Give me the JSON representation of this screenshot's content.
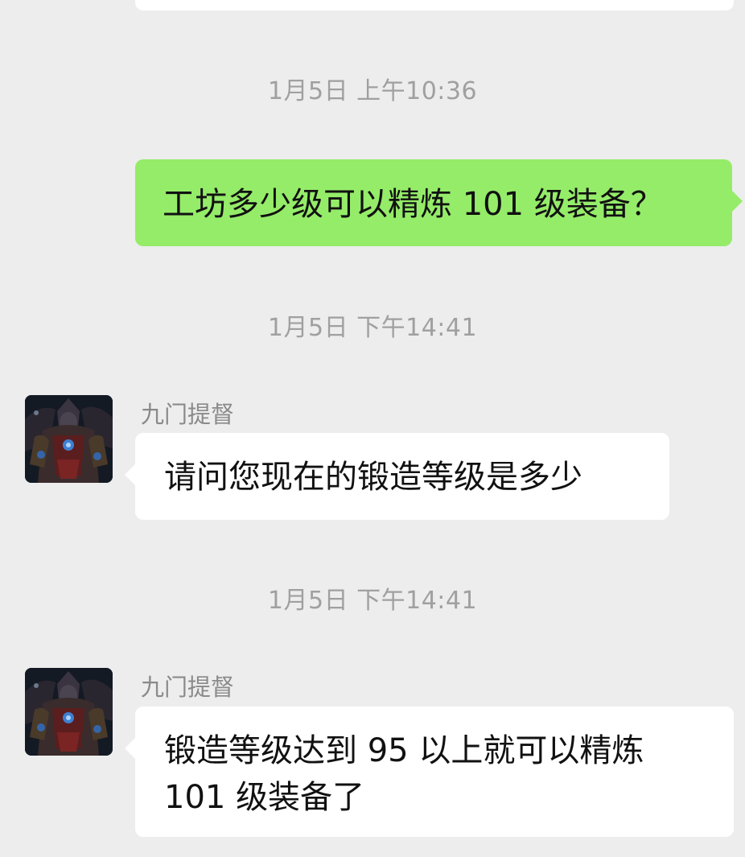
{
  "chat": {
    "messages": [
      {
        "timestamp": "1月5日 上午10:36",
        "direction": "sent",
        "text": "工坊多少级可以精炼 101 级装备？"
      },
      {
        "timestamp": "1月5日 下午14:41",
        "direction": "received",
        "sender": "九门提督",
        "avatar_icon": "dark-armored-warrior-avatar-icon",
        "text": "请问您现在的锻造等级是多少"
      },
      {
        "timestamp": "1月5日 下午14:41",
        "direction": "received",
        "sender": "九门提督",
        "avatar_icon": "dark-armored-warrior-avatar-icon",
        "text_lines": [
          "锻造等级达到 95 以上就可以精炼",
          "101 级装备了"
        ]
      }
    ]
  },
  "colors": {
    "background": "#ededed",
    "sent_bubble": "#95ec69",
    "received_bubble": "#ffffff",
    "timestamp_text": "#a0a0a0",
    "sender_name_text": "#8a8a8a"
  }
}
